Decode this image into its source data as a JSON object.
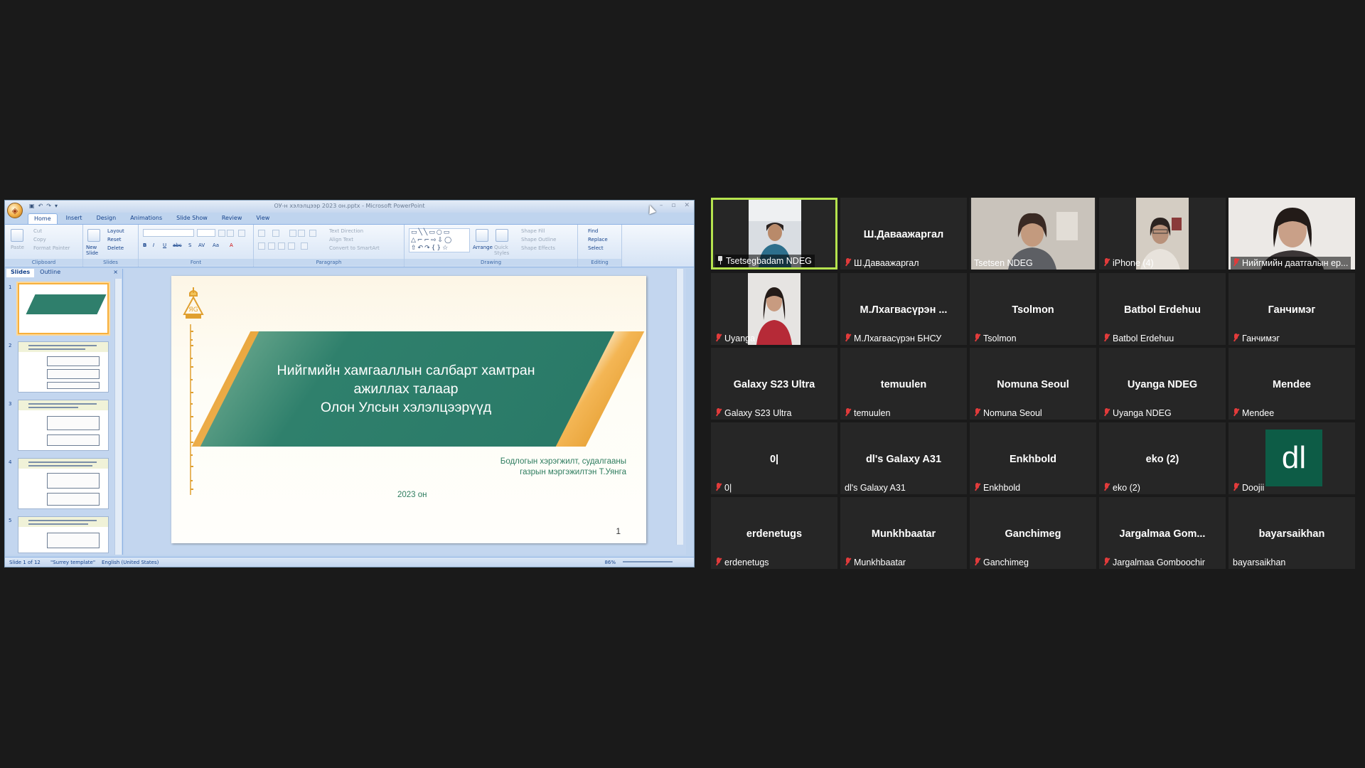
{
  "ppt": {
    "window_title": "ОУ-н хэлэлцээр 2023 он.pptx - Microsoft PowerPoint",
    "tabs": [
      "Home",
      "Insert",
      "Design",
      "Animations",
      "Slide Show",
      "Review",
      "View"
    ],
    "ribbon": {
      "clipboard": {
        "label": "Clipboard",
        "paste": "Paste",
        "cut": "Cut",
        "copy": "Copy",
        "format_painter": "Format Painter"
      },
      "slides": {
        "label": "Slides",
        "new_slide": "New Slide",
        "layout": "Layout",
        "reset": "Reset",
        "delete": "Delete"
      },
      "font": {
        "label": "Font"
      },
      "paragraph": {
        "label": "Paragraph",
        "text_direction": "Text Direction",
        "align_text": "Align Text",
        "smartart": "Convert to SmartArt"
      },
      "drawing": {
        "label": "Drawing",
        "arrange": "Arrange",
        "quick_styles": "Quick Styles",
        "shape_fill": "Shape Fill",
        "shape_outline": "Shape Outline",
        "shape_effects": "Shape Effects"
      },
      "editing": {
        "label": "Editing",
        "find": "Find",
        "replace": "Replace",
        "select": "Select"
      }
    },
    "pane": {
      "tab_slides": "Slides",
      "tab_outline": "Outline",
      "close": "×"
    },
    "thumbnails": [
      "1",
      "2",
      "3",
      "4",
      "5"
    ],
    "slide": {
      "title_lines": [
        "Нийгмийн хамгааллын салбарт хамтран",
        "ажиллах талаар",
        "Олон Улсын хэлэлцээрүүд"
      ],
      "subtitle_lines": [
        "Бодлогын хэрэгжилт, судалгааны",
        "газрын мэргэжилтэн Т.Уянга"
      ],
      "year": "2023 он",
      "page_number": "1"
    },
    "status": {
      "slide_of": "Slide 1 of 12",
      "template": "\"Surrey template\"",
      "language": "English (United States)",
      "zoom": "86%"
    },
    "colors": {
      "band": "#2f806c",
      "accent": "#e9a234",
      "text_green": "#2e7d5f"
    }
  },
  "participants": [
    {
      "label": "Tsetsegbadam NDEG",
      "video": true,
      "speaking": true,
      "pinned": true,
      "muted": false
    },
    {
      "label": "Ш.Даваажаргал",
      "center": "Ш.Даваажаргал",
      "muted": true
    },
    {
      "label": "Tsetsen NDEG",
      "video": true,
      "muted": false
    },
    {
      "label": "iPhone (4)",
      "video": true,
      "muted": true
    },
    {
      "label": "Нийгмийн даатгалын ер...",
      "video": true,
      "muted": true
    },
    {
      "label": "Uyanga",
      "video": true,
      "muted": true
    },
    {
      "label": "М.Лхагвасүрэн БНСУ",
      "center": "М.Лхагвасүрэн ...",
      "muted": true
    },
    {
      "label": "Tsolmon",
      "center": "Tsolmon",
      "muted": true
    },
    {
      "label": "Batbol Erdehuu",
      "center": "Batbol Erdehuu",
      "muted": true
    },
    {
      "label": "Ганчимэг",
      "center": "Ганчимэг",
      "muted": true
    },
    {
      "label": "Galaxy S23 Ultra",
      "center": "Galaxy S23 Ultra",
      "muted": true
    },
    {
      "label": "temuulen",
      "center": "temuulen",
      "muted": true
    },
    {
      "label": "Nomuna Seoul",
      "center": "Nomuna Seoul",
      "muted": true
    },
    {
      "label": "Uyanga  NDEG",
      "center": "Uyanga  NDEG",
      "muted": true
    },
    {
      "label": "Mendee",
      "center": "Mendee",
      "muted": true
    },
    {
      "label": "0|",
      "center": "0|",
      "muted": true
    },
    {
      "label": "dl's Galaxy A31",
      "center": "dl's Galaxy A31",
      "muted": false
    },
    {
      "label": "Enkhbold",
      "center": "Enkhbold",
      "muted": true
    },
    {
      "label": "eko (2)",
      "center": "eko (2)",
      "muted": true
    },
    {
      "label": "Doojii",
      "avatar": "dl",
      "muted": true
    },
    {
      "label": "erdenetugs",
      "center": "erdenetugs",
      "muted": true
    },
    {
      "label": "Munkhbaatar",
      "center": "Munkhbaatar",
      "muted": true
    },
    {
      "label": "Ganchimeg",
      "center": "Ganchimeg",
      "muted": true
    },
    {
      "label": "Jargalmaa Gomboochir",
      "center": "Jargalmaa  Gom...",
      "muted": true
    },
    {
      "label": "bayarsaikhan",
      "center": "bayarsaikhan",
      "muted": false
    }
  ]
}
